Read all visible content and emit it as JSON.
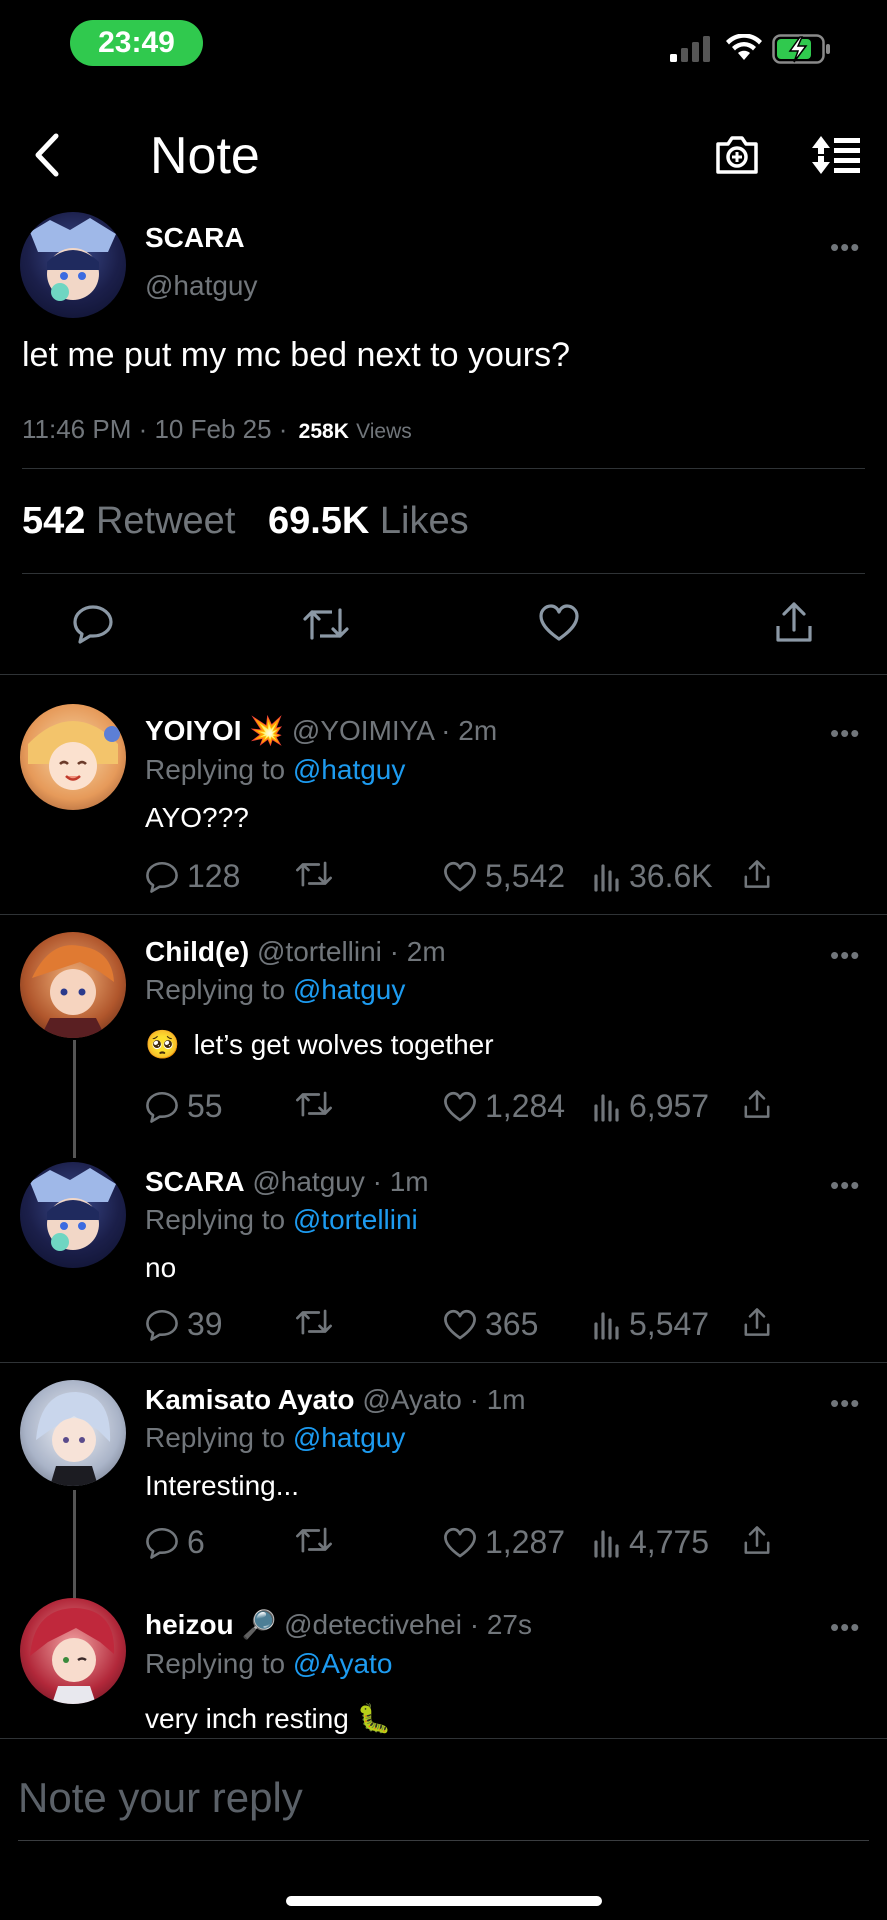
{
  "status_bar": {
    "time": "23:49"
  },
  "header": {
    "title": "Note"
  },
  "main_post": {
    "display_name": "SCARA",
    "handle": "@hatguy",
    "text": "let me put my mc bed next to yours?",
    "time": "11:46 PM · 10 Feb 25 ·",
    "views_count": "258K",
    "views_label": "Views",
    "retweet_count": "542",
    "retweet_label": "Retweet",
    "likes_count": "69.5K",
    "likes_label": "Likes",
    "more": "•••"
  },
  "replies": [
    {
      "display_name": "YOIYOI",
      "emoji": "💥",
      "handle": "@YOIMIYA · 2m",
      "replying_prefix": "Replying to",
      "replying_to": "@hatguy",
      "text": "AYO???",
      "comments": "128",
      "likes": "5,542",
      "views": "36.6K",
      "more": "•••"
    },
    {
      "display_name": "Child(e)",
      "emoji": "",
      "handle": "@tortellini · 2m",
      "replying_prefix": "Replying to",
      "replying_to": "@hatguy",
      "text_emoji": "🥺",
      "text": "let’s get wolves together",
      "comments": "55",
      "likes": "1,284",
      "views": "6,957",
      "more": "•••"
    },
    {
      "display_name": "SCARA",
      "emoji": "",
      "handle": "@hatguy · 1m",
      "replying_prefix": "Replying to",
      "replying_to": "@tortellini",
      "text": "no",
      "comments": "39",
      "likes": "365",
      "views": "5,547",
      "more": "•••"
    },
    {
      "display_name": "Kamisato Ayato",
      "emoji": "",
      "handle": "@Ayato · 1m",
      "replying_prefix": "Replying to",
      "replying_to": "@hatguy",
      "text": "Interesting...",
      "comments": "6",
      "likes": "1,287",
      "views": "4,775",
      "more": "•••"
    },
    {
      "display_name": "heizou",
      "emoji": "🔎",
      "handle": "@detectivehei · 27s",
      "replying_prefix": "Replying to",
      "replying_to": "@Ayato",
      "text": "very inch resting",
      "text_emoji_after": "🐛",
      "more": "•••"
    }
  ],
  "reply_box": {
    "placeholder": "Note your reply"
  }
}
